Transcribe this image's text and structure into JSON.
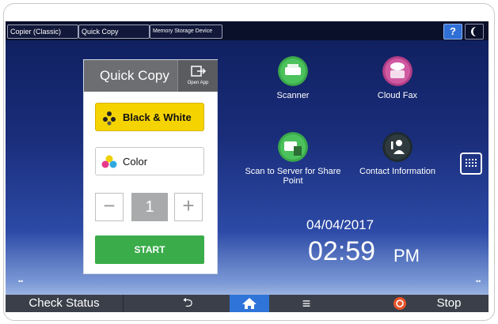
{
  "top_tabs": [
    {
      "label": "Copier (Classic)"
    },
    {
      "label": "Quick Copy"
    },
    {
      "label": "Memory Storage Device"
    }
  ],
  "help_label": "?",
  "quick_copy": {
    "title": "Quick Copy",
    "open_app_label": "Open App",
    "bw_label": "Black & White",
    "color_label": "Color",
    "minus_label": "−",
    "plus_label": "+",
    "quantity": "1",
    "start_label": "START"
  },
  "apps": [
    {
      "label": "Scanner",
      "icon": "scanner-icon"
    },
    {
      "label": "Cloud Fax",
      "icon": "cloud-fax-icon"
    },
    {
      "label": "Scan to Server for Share Point",
      "icon": "scan-to-server-icon"
    },
    {
      "label": "Contact Information",
      "icon": "contact-info-icon"
    }
  ],
  "date": "04/04/2017",
  "time": "02:59",
  "ampm": "PM",
  "bottom_bar": {
    "check_status": "Check Status",
    "back_label": "⮌",
    "menu_label": "≡",
    "stop_label": "Stop"
  },
  "colors": {
    "screen_top": "#0e1e5c",
    "bw_button": "#f5d300",
    "start_button": "#3aac4a",
    "home_button": "#2f74d8",
    "panel_header": "#6d6e72"
  }
}
